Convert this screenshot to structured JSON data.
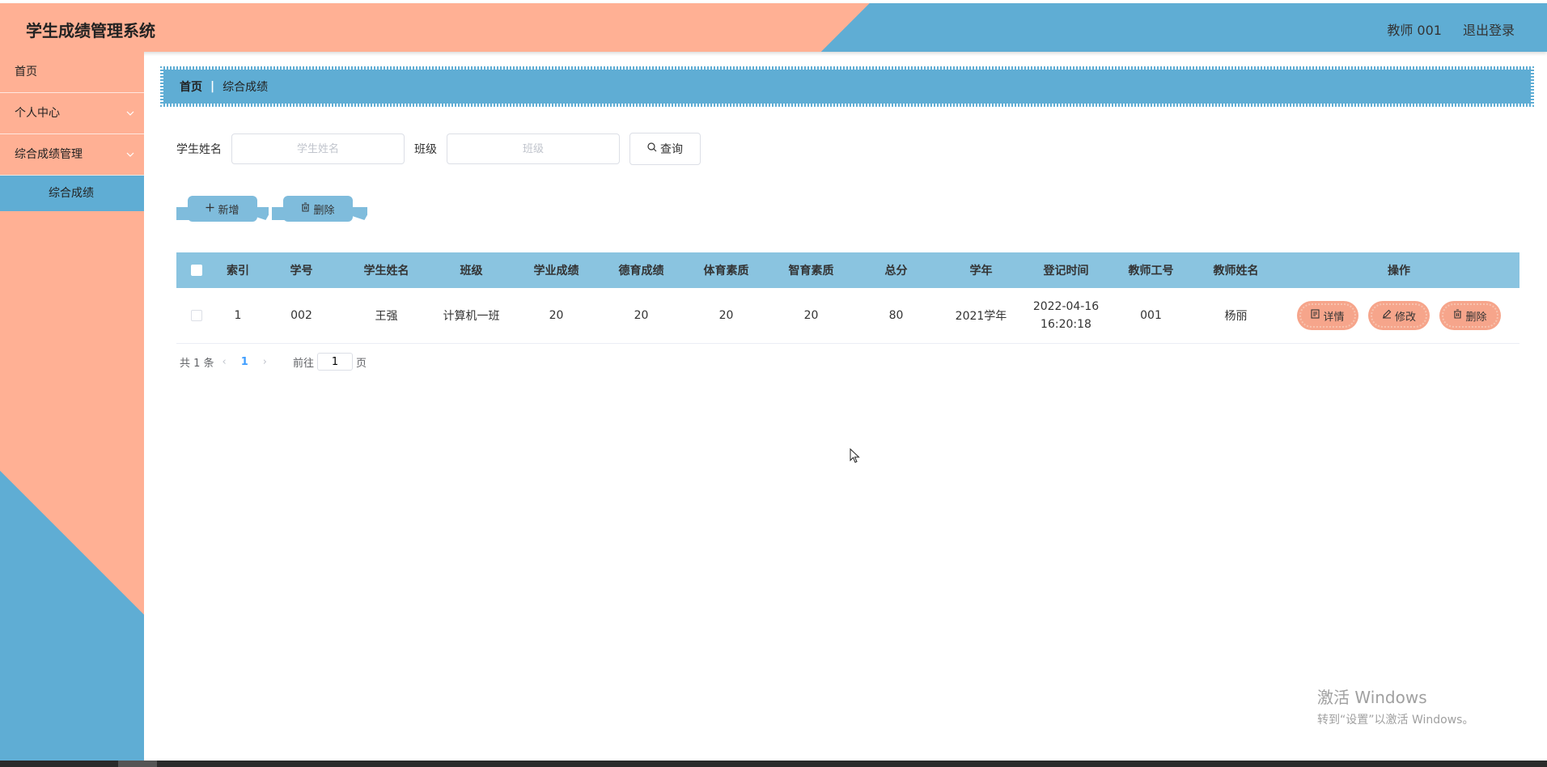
{
  "header": {
    "title": "学生成绩管理系统",
    "user": "教师 001",
    "logout": "退出登录"
  },
  "sidebar": {
    "items": [
      {
        "label": "首页"
      },
      {
        "label": "个人中心"
      },
      {
        "label": "综合成绩管理"
      }
    ],
    "sub_items": [
      {
        "label": "综合成绩"
      }
    ]
  },
  "breadcrumb": {
    "home": "首页",
    "separator": "|",
    "current": "综合成绩"
  },
  "search": {
    "name_label": "学生姓名",
    "name_placeholder": "学生姓名",
    "class_label": "班级",
    "class_placeholder": "班级",
    "query_label": "查询"
  },
  "actions": {
    "add_label": "新增",
    "delete_label": "删除"
  },
  "table": {
    "headers": [
      "索引",
      "学号",
      "学生姓名",
      "班级",
      "学业成绩",
      "德育成绩",
      "体育素质",
      "智育素质",
      "总分",
      "学年",
      "登记时间",
      "教师工号",
      "教师姓名",
      "操作"
    ],
    "rows": [
      {
        "index": "1",
        "student_no": "002",
        "student_name": "王强",
        "class": "计算机一班",
        "academic": "20",
        "moral": "20",
        "sports": "20",
        "intellect": "20",
        "total": "80",
        "year": "2021学年",
        "reg_date": "2022-04-16",
        "reg_time": "16:20:18",
        "teacher_no": "001",
        "teacher_name": "杨丽"
      }
    ],
    "ops": {
      "detail": "详情",
      "edit": "修改",
      "delete": "删除"
    }
  },
  "pagination": {
    "total": "共 1 条",
    "current_page": "1",
    "goto_label": "前往",
    "goto_value": "1",
    "page_suffix": "页"
  },
  "watermark": {
    "line1": "激活 Windows",
    "line2": "转到“设置”以激活 Windows。"
  },
  "colors": {
    "salmon": "#ffb094",
    "blue": "#5fadd4",
    "table_header": "#8ac4e0",
    "op_button": "#f6a58b"
  }
}
